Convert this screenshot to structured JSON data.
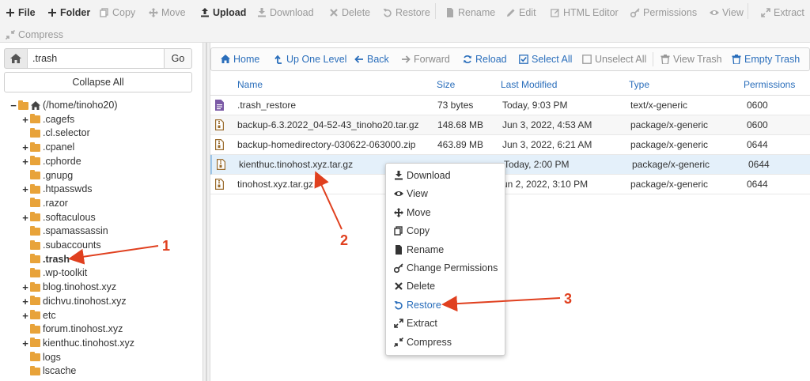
{
  "toolbar": {
    "items": [
      {
        "label": "File",
        "icon": "plus-icon",
        "enabled": true
      },
      {
        "label": "Folder",
        "icon": "plus-icon",
        "enabled": true
      },
      {
        "label": "Copy",
        "icon": "copy-icon",
        "enabled": false
      },
      {
        "label": "Move",
        "icon": "move-icon",
        "enabled": false
      },
      {
        "label": "Upload",
        "icon": "upload-icon",
        "enabled": true
      },
      {
        "label": "Download",
        "icon": "download-icon",
        "enabled": false
      },
      {
        "label": "Delete",
        "icon": "x-icon",
        "enabled": false
      },
      {
        "label": "Restore",
        "icon": "undo-icon",
        "enabled": false
      },
      {
        "label": "Rename",
        "icon": "file-icon",
        "enabled": false
      },
      {
        "label": "Edit",
        "icon": "pencil-icon",
        "enabled": false
      },
      {
        "label": "HTML Editor",
        "icon": "edit-icon",
        "enabled": false
      },
      {
        "label": "Permissions",
        "icon": "key-icon",
        "enabled": false
      },
      {
        "label": "View",
        "icon": "eye-icon",
        "enabled": false
      },
      {
        "label": "Extract",
        "icon": "expand-icon",
        "enabled": false
      },
      {
        "label": "Compress",
        "icon": "compress-icon",
        "enabled": false
      }
    ]
  },
  "left": {
    "path_value": ".trash",
    "go_label": "Go",
    "collapse_label": "Collapse All",
    "tree": [
      {
        "label": "(/home/tinoho20)",
        "expand": "−",
        "root": true
      },
      {
        "label": ".cagefs",
        "expand": "+"
      },
      {
        "label": ".cl.selector",
        "expand": ""
      },
      {
        "label": ".cpanel",
        "expand": "+"
      },
      {
        "label": ".cphorde",
        "expand": "+"
      },
      {
        "label": ".gnupg",
        "expand": ""
      },
      {
        "label": ".htpasswds",
        "expand": "+"
      },
      {
        "label": ".razor",
        "expand": ""
      },
      {
        "label": ".softaculous",
        "expand": "+"
      },
      {
        "label": ".spamassassin",
        "expand": ""
      },
      {
        "label": ".subaccounts",
        "expand": ""
      },
      {
        "label": ".trash",
        "expand": "",
        "selected": true
      },
      {
        "label": ".wp-toolkit",
        "expand": ""
      },
      {
        "label": "blog.tinohost.xyz",
        "expand": "+"
      },
      {
        "label": "dichvu.tinohost.xyz",
        "expand": "+"
      },
      {
        "label": "etc",
        "expand": "+"
      },
      {
        "label": "forum.tinohost.xyz",
        "expand": ""
      },
      {
        "label": "kienthuc.tinohost.xyz",
        "expand": "+"
      },
      {
        "label": "logs",
        "expand": ""
      },
      {
        "label": "lscache",
        "expand": ""
      }
    ]
  },
  "nav": {
    "items": [
      {
        "label": "Home",
        "icon": "home-icon",
        "enabled": true
      },
      {
        "label": "Up One Level",
        "icon": "level-up-icon",
        "enabled": true
      },
      {
        "label": "Back",
        "icon": "arrow-left-icon",
        "enabled": true
      },
      {
        "label": "Forward",
        "icon": "arrow-right-icon",
        "enabled": false
      },
      {
        "label": "Reload",
        "icon": "refresh-icon",
        "enabled": true
      },
      {
        "label": "Select All",
        "icon": "checkbox-checked-icon",
        "enabled": true
      },
      {
        "label": "Unselect All",
        "icon": "checkbox-empty-icon",
        "enabled": false
      },
      {
        "label": "View Trash",
        "icon": "trash-icon",
        "enabled": false
      },
      {
        "label": "Empty Trash",
        "icon": "trash-icon",
        "enabled": true
      }
    ]
  },
  "table": {
    "headers": {
      "name": "Name",
      "size": "Size",
      "modified": "Last Modified",
      "type": "Type",
      "perms": "Permissions"
    },
    "rows": [
      {
        "name": ".trash_restore",
        "size": "73 bytes",
        "modified": "Today, 9:03 PM",
        "type": "text/x-generic",
        "perms": "0600",
        "icon": "text-file-icon"
      },
      {
        "name": "backup-6.3.2022_04-52-43_tinoho20.tar.gz",
        "size": "148.68 MB",
        "modified": "Jun 3, 2022, 4:53 AM",
        "type": "package/x-generic",
        "perms": "0600",
        "icon": "archive-file-icon"
      },
      {
        "name": "backup-homedirectory-030622-063000.zip",
        "size": "463.89 MB",
        "modified": "Jun 3, 2022, 6:21 AM",
        "type": "package/x-generic",
        "perms": "0644",
        "icon": "archive-file-icon"
      },
      {
        "name": "kienthuc.tinohost.xyz.tar.gz",
        "size": "",
        "modified": "Today, 2:00 PM",
        "type": "package/x-generic",
        "perms": "0644",
        "icon": "archive-file-icon",
        "selected": true
      },
      {
        "name": "tinohost.xyz.tar.gz",
        "size": "",
        "modified": "un 2, 2022, 3:10 PM",
        "type": "package/x-generic",
        "perms": "0644",
        "icon": "archive-file-icon"
      }
    ]
  },
  "context_menu": {
    "items": [
      {
        "label": "Download",
        "icon": "download-icon"
      },
      {
        "label": "View",
        "icon": "eye-icon"
      },
      {
        "label": "Move",
        "icon": "move-icon"
      },
      {
        "label": "Copy",
        "icon": "copy-icon"
      },
      {
        "label": "Rename",
        "icon": "file-icon"
      },
      {
        "label": "Change Permissions",
        "icon": "key-icon"
      },
      {
        "label": "Delete",
        "icon": "x-icon"
      },
      {
        "label": "Restore",
        "icon": "undo-icon",
        "active": true
      },
      {
        "label": "Extract",
        "icon": "expand-icon"
      },
      {
        "label": "Compress",
        "icon": "compress-icon"
      }
    ]
  },
  "annotations": {
    "labels": [
      "1",
      "2",
      "3"
    ],
    "color": "#e0401f"
  },
  "colors": {
    "link": "#2a6ebb",
    "folder": "#e8a33a",
    "selected_row": "#e4f0fa"
  }
}
